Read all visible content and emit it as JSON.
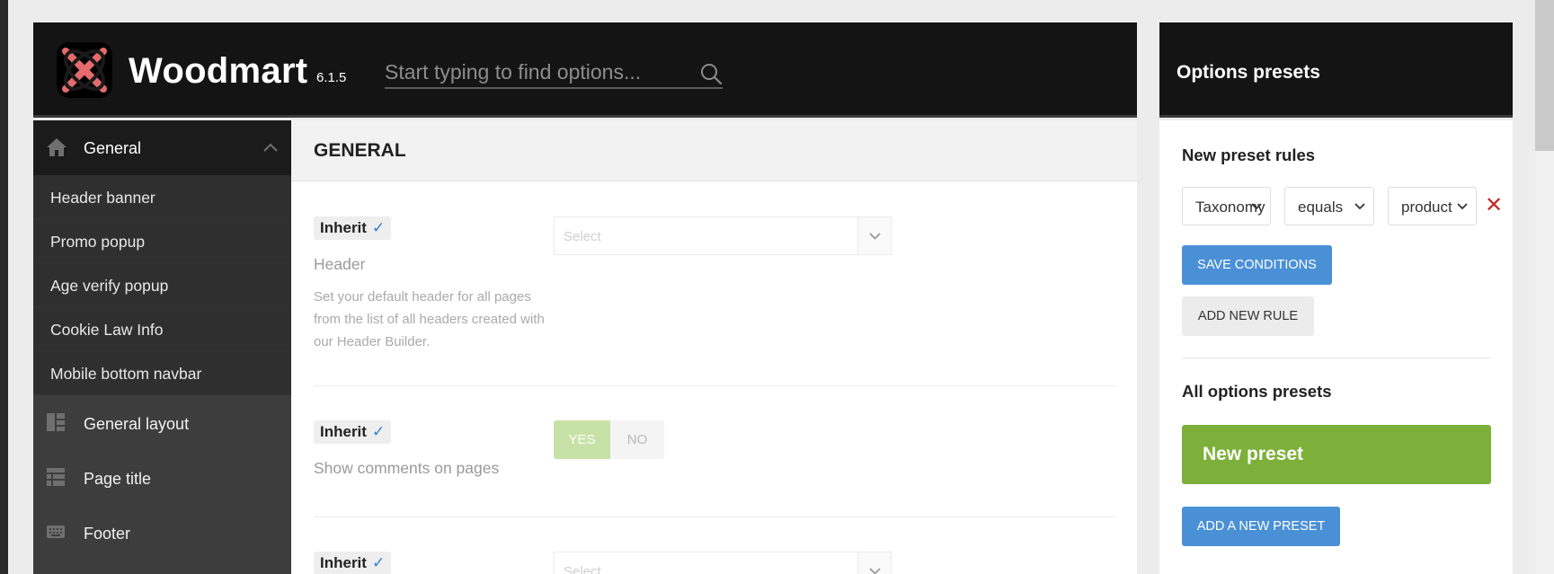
{
  "app": {
    "brand": "Woodmart",
    "version": "6.1.5",
    "search_placeholder": "Start typing to find options..."
  },
  "sidebar": {
    "active_section": "General",
    "sub_items": [
      "Header banner",
      "Promo popup",
      "Age verify popup",
      "Cookie Law Info",
      "Mobile bottom navbar"
    ],
    "sections": [
      {
        "label": "General layout",
        "icon": "layout-icon"
      },
      {
        "label": "Page title",
        "icon": "page-title-icon"
      },
      {
        "label": "Footer",
        "icon": "keyboard-icon"
      }
    ]
  },
  "main": {
    "title": "GENERAL",
    "inherit_label": "Inherit",
    "options": [
      {
        "label": "Header",
        "description": "Set your default header for all pages from the list of all headers created with our Header Builder.",
        "control": "select",
        "placeholder": "Select"
      },
      {
        "label": "Show comments on pages",
        "control": "toggle",
        "yes": "YES",
        "no": "NO",
        "selected": "YES"
      },
      {
        "label": "",
        "control": "select",
        "placeholder": "Select"
      }
    ]
  },
  "presets": {
    "title": "Options presets",
    "new_rules_heading": "New preset rules",
    "rule": {
      "type": "Taxonomy",
      "comparison": "equals",
      "value": "product"
    },
    "save_conditions": "SAVE CONDITIONS",
    "add_new_rule": "ADD NEW RULE",
    "all_heading": "All options presets",
    "items": [
      "New preset"
    ],
    "add_preset": "ADD A NEW PRESET"
  },
  "colors": {
    "dark": "#141414",
    "sidebar": "#3d3d3d",
    "accent_blue": "#4a90d6",
    "preset_green": "#7cb03a",
    "toggle_yes": "#c7e2a6",
    "remove_red": "#c62828"
  }
}
